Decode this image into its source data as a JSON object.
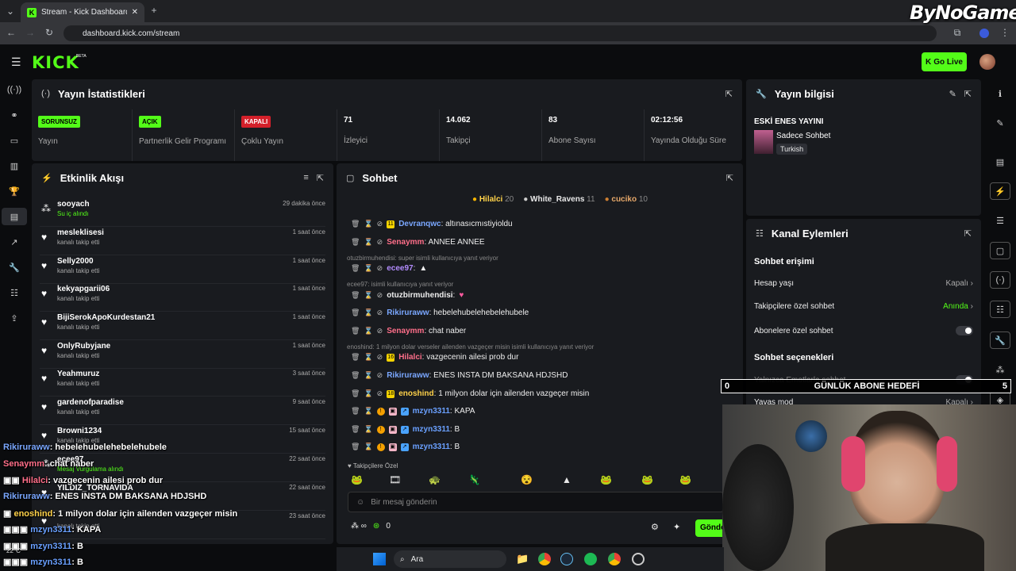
{
  "browser": {
    "tab_title": "Stream - Kick Dashboard",
    "url": "dashboard.kick.com/stream",
    "watermark": "ByNoGame"
  },
  "header": {
    "logo": "KICK",
    "logo_badge": "BETA",
    "go_live": "Go Live"
  },
  "stats": {
    "title": "Yayın İstatistikleri",
    "cells": [
      {
        "badge": "SORUNSUZ",
        "label": "Yayın"
      },
      {
        "badge": "AÇIK",
        "label": "Partnerlik Gelir Programı"
      },
      {
        "badge": "KAPALI",
        "label": "Çoklu Yayın"
      },
      {
        "value": "71",
        "label": "İzleyici"
      },
      {
        "value": "14.062",
        "label": "Takipçi"
      },
      {
        "value": "83",
        "label": "Abone Sayısı"
      },
      {
        "value": "02:12:56",
        "label": "Yayında Olduğu Süre"
      }
    ]
  },
  "activity": {
    "title": "Etkinlik Akışı",
    "items": [
      {
        "name": "sooyach",
        "action": "Su iç alındı",
        "time": "29 dakika önce"
      },
      {
        "name": "mesleklisesi",
        "action": "kanalı takip etti",
        "time": "1 saat önce"
      },
      {
        "name": "Selly2000",
        "action": "kanalı takip etti",
        "time": "1 saat önce"
      },
      {
        "name": "kekyapgarii06",
        "action": "kanalı takip etti",
        "time": "1 saat önce"
      },
      {
        "name": "BijiSerokApoKurdestan21",
        "action": "kanalı takip etti",
        "time": "1 saat önce"
      },
      {
        "name": "OnlyRubyjane",
        "action": "kanalı takip etti",
        "time": "1 saat önce"
      },
      {
        "name": "Yeahmuruz",
        "action": "kanalı takip etti",
        "time": "3 saat önce"
      },
      {
        "name": "gardenofparadise",
        "action": "kanalı takip etti",
        "time": "9 saat önce"
      },
      {
        "name": "Browni1234",
        "action": "kanalı takip etti",
        "time": "15 saat önce"
      },
      {
        "name": "ecee97",
        "action": "Mesaj Vurgulama alındı",
        "time": "22 saat önce"
      },
      {
        "name": "YILDIZ_TORNAVIDA",
        "action": "",
        "time": "22 saat önce"
      },
      {
        "name": "",
        "action": "kanalı takip etti",
        "time": "23 saat önce"
      }
    ]
  },
  "chat": {
    "title": "Sohbet",
    "pinned": [
      {
        "name": "Hilalci",
        "count": "20"
      },
      {
        "name": "White_Ravens",
        "count": "11"
      },
      {
        "name": "cuciko",
        "count": "10"
      }
    ],
    "messages": [
      {
        "user": "Devranqwc",
        "text": ": altınasıcmıstiyioldu",
        "color": "#7aa7ff"
      },
      {
        "user": "Senaymm",
        "text": ": ANNEE ANNEE",
        "color": "#ff6f8a"
      },
      {
        "reply": "otuzbirmuhendisi: super isimli kullanıcıya yanıt veriyor"
      },
      {
        "user": "ecee97",
        "text": ":",
        "color": "#b38cff"
      },
      {
        "reply": "ecee97: isimli kullanıcıya yanıt veriyor"
      },
      {
        "user": "otuzbirmuhendisi",
        "text": ":",
        "color": "#ffffff"
      },
      {
        "user": "Rikiruraww",
        "text": ": hebelehubelehebelehubele",
        "color": "#7aa7ff"
      },
      {
        "user": "Senaymm",
        "text": ": chat naber",
        "color": "#ff6f8a"
      },
      {
        "reply": "enoshind: 1 milyon dolar verseler ailenden vazgeçer misin isimli kullanıcıya yanıt veriyor"
      },
      {
        "user": "Hilalci",
        "text": ": vazgecenin ailesi prob dur",
        "color": "#ff6f8a"
      },
      {
        "user": "Rikiruraww",
        "text": ": ENES INSTA DM BAKSANA HDJSHD",
        "color": "#7aa7ff"
      },
      {
        "user": "enoshind",
        "text": ": 1 milyon dolar için ailenden vazgeçer misin",
        "color": "#ffd24a"
      },
      {
        "user": "mzyn3311",
        "text": ": KAPA",
        "color": "#6aa0ff"
      },
      {
        "user": "mzyn3311",
        "text": ": B",
        "color": "#6aa0ff"
      },
      {
        "user": "mzyn3311",
        "text": ": B",
        "color": "#6aa0ff"
      }
    ],
    "followers_only": "Takipçilere Özel",
    "input_placeholder": "Bir mesaj gönderin",
    "footer_count": "0",
    "send": "Gönder"
  },
  "stream_info": {
    "title": "Yayın bilgisi",
    "stream_title": "ESKİ ENES YAYINI",
    "category": "Sadece Sohbet",
    "language": "Turkish"
  },
  "channel_actions": {
    "title": "Kanal Eylemleri",
    "chat_access": "Sohbet erişimi",
    "rows": [
      {
        "label": "Hesap yaşı",
        "value": "Kapalı"
      },
      {
        "label": "Takipçilere özel sohbet",
        "value": "Anında"
      },
      {
        "label": "Abonelere özel sohbet",
        "value": ""
      }
    ],
    "chat_options": "Sohbet seçenekleri",
    "rows2": [
      {
        "label": "Yalnızca Emotlarla sohbet",
        "value": ""
      },
      {
        "label": "Yavaş mod",
        "value": "Kapalı"
      }
    ]
  },
  "goal_bar": {
    "left": "0",
    "title": "GÜNLÜK ABONE HEDEFİ",
    "right": "5"
  },
  "overlay_chat": [
    {
      "user": "Rikiruraww",
      "text": ": hebelehubelehebelehubele",
      "color": "#7aa7ff"
    },
    {
      "user": "Senaymm",
      "text": ": chat naber",
      "color": "#ff6f8a"
    },
    {
      "user": "Hilalci",
      "text": ": vazgecenin ailesi prob dur",
      "color": "#ff6f8a"
    },
    {
      "user": "Rikiruraww",
      "text": ": ENES INSTA DM BAKSANA HDJSHD",
      "color": "#7aa7ff"
    },
    {
      "user": "enoshind",
      "text": ": 1 milyon dolar için ailenden vazgeçer misin",
      "color": "#ffd24a"
    },
    {
      "user": "mzyn3311",
      "text": ": KAPA",
      "color": "#6aa0ff"
    },
    {
      "user": "mzyn3311",
      "text": ": B",
      "color": "#6aa0ff"
    },
    {
      "user": "mzyn3311",
      "text": ": B",
      "color": "#6aa0ff"
    }
  ],
  "taskbar": {
    "search": "Ara",
    "temp": "22°C"
  },
  "colors": {
    "accent": "#53fc18",
    "panel": "#191b1f",
    "danger": "#d3202a"
  }
}
